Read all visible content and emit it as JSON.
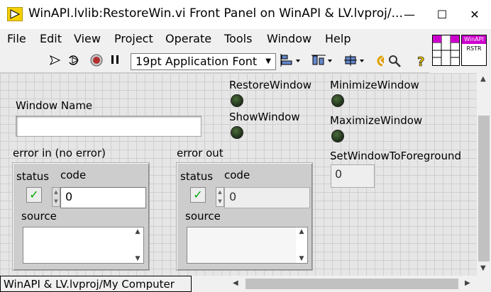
{
  "window": {
    "title": "WinAPI.lvlib:RestoreWin.vi Front Panel on WinAPI & LV.lvproj/...",
    "buttons": {
      "minimize": "—",
      "maximize": "☐",
      "close": "✕"
    }
  },
  "menu": {
    "items": [
      "File",
      "Edit",
      "View",
      "Project",
      "Operate",
      "Tools",
      "Window",
      "Help"
    ]
  },
  "toolbar": {
    "font_selector": "19pt Application Font",
    "icons": [
      "run-arrow-icon",
      "run-continuously-icon",
      "abort-icon",
      "pause-icon",
      "align-icon",
      "distribute-icon",
      "resize-icon",
      "reorder-icon",
      "search-icon",
      "help-icon"
    ]
  },
  "vi_icon": {
    "line1": "WinAPI",
    "line2": "RSTR",
    "accent_color": "#cc00cc"
  },
  "panel": {
    "window_name_label": "Window Name",
    "window_name_value": "",
    "restore_label": "RestoreWindow",
    "show_label": "ShowWindow",
    "minimize_label": "MinimizeWindow",
    "maximize_label": "MaximizeWindow",
    "foreground_label": "SetWindowToForeground",
    "foreground_value": "0",
    "error_in": {
      "label": "error in (no error)",
      "status_label": "status",
      "code_label": "code",
      "code_value": "0",
      "source_label": "source",
      "source_value": ""
    },
    "error_out": {
      "label": "error out",
      "status_label": "status",
      "code_label": "code",
      "code_value": "0",
      "source_label": "source",
      "source_value": ""
    }
  },
  "status": {
    "context": "WinAPI & LV.lvproj/My Computer"
  }
}
